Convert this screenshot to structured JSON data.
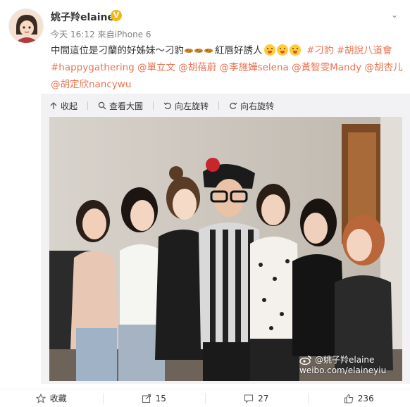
{
  "post": {
    "username": "姚子羚elaine",
    "verified_badge": "V",
    "meta": {
      "date": "今天",
      "time": "16:12",
      "source": "來自iPhone 6"
    },
    "content": {
      "part1": "中間這位是刁蘭的好姊妹～刁豹",
      "part2": "紅唇好誘人",
      "tag1": "#刁豹",
      "tag2": "#胡說八道會",
      "tag3": "#happygathering",
      "mention1": "@單立文",
      "mention2": "@胡蓓蔚",
      "mention3": "@李施嬅selena",
      "mention4": "@黃智雯Mandy",
      "mention5": "@胡杏儿",
      "mention6": "@胡定欣nancywu"
    }
  },
  "media_toolbar": {
    "collapse": "收起",
    "view_large": "查看大圖",
    "rotate_left": "向左旋转",
    "rotate_right": "向右旋转"
  },
  "watermark": {
    "line1": "@姚子羚elaine",
    "line2": "weibo.com/elaineyiu"
  },
  "actions": {
    "favorite": "收藏",
    "repost_count": "15",
    "comment_count": "27",
    "like_count": "236"
  },
  "colors": {
    "link": "#eb7350",
    "badge": "#f7b614",
    "media_bg": "#f2f2f5"
  },
  "icons": [
    "chevron-down-icon",
    "verified-icon",
    "collapse-icon",
    "zoom-icon",
    "rotate-left-icon",
    "rotate-right-icon",
    "repost-icon",
    "comment-icon",
    "like-icon",
    "weibo-logo-icon"
  ]
}
